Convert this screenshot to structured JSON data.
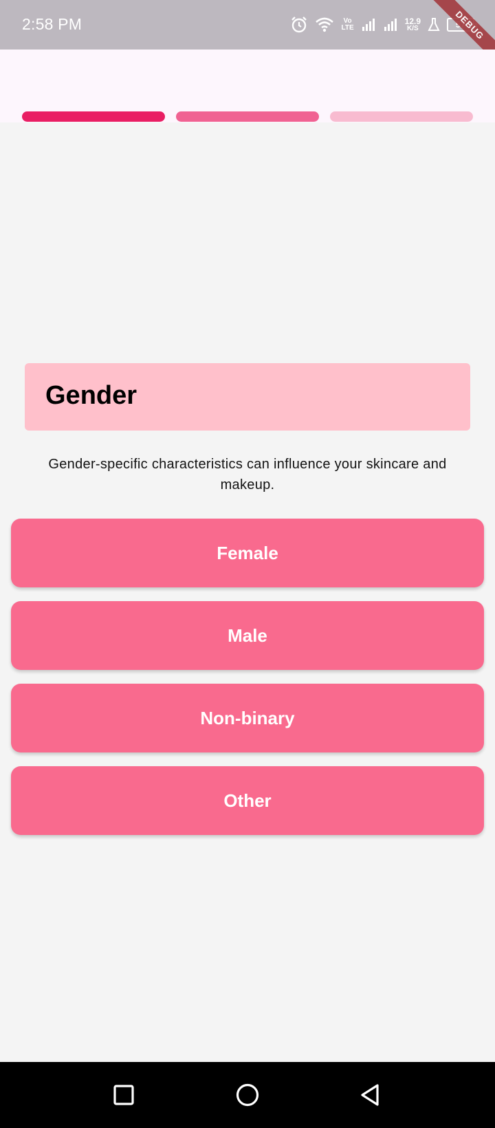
{
  "status_bar": {
    "time": "2:58 PM",
    "icons": [
      "alarm-icon",
      "wifi-icon",
      "volte-icon",
      "signal-icon",
      "signal-icon",
      "data-speed-icon",
      "lab-icon",
      "battery-icon"
    ],
    "volte_top": "Vo",
    "volte_bottom": "LTE",
    "speed_value": "12.9",
    "speed_unit": "K/S",
    "battery_level": "57",
    "debug_banner": "DEBUG"
  },
  "progress": {
    "segments": 3,
    "colors": [
      "#e91e63",
      "#f06292",
      "#f8bbd0"
    ]
  },
  "question": {
    "title": "Gender",
    "description": "Gender-specific characteristics can influence your skincare and makeup."
  },
  "options": [
    {
      "label": "Female"
    },
    {
      "label": "Male"
    },
    {
      "label": "Non-binary"
    },
    {
      "label": "Other"
    }
  ],
  "nav_bar": {
    "icons": [
      "recents-icon",
      "home-icon",
      "back-icon"
    ]
  },
  "colors": {
    "accent": "#f96a8e",
    "title_card": "#ffc0cb",
    "background": "#f4f4f4"
  }
}
